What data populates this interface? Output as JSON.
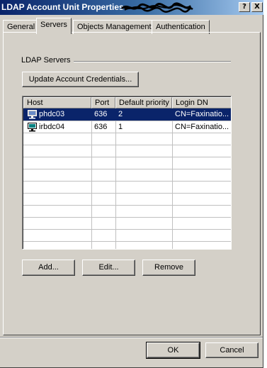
{
  "window": {
    "title": "LDAP Account Unit Properties -",
    "help_btn": "?",
    "close_btn": "X"
  },
  "tabs": [
    {
      "label": "General",
      "active": false
    },
    {
      "label": "Servers",
      "active": true
    },
    {
      "label": "Objects Management",
      "active": false
    },
    {
      "label": "Authentication",
      "active": false
    }
  ],
  "servers": {
    "group_label": "LDAP Servers",
    "update_button": "Update Account Credentials...",
    "columns": [
      "Host",
      "Port",
      "Default priority",
      "Login DN"
    ],
    "rows": [
      {
        "host": "phdc03",
        "port": "636",
        "priority": "2",
        "login_dn": "CN=Faxinatio...",
        "selected": true
      },
      {
        "host": "irbdc04",
        "port": "636",
        "priority": "1",
        "login_dn": "CN=Faxinatio...",
        "selected": false
      }
    ],
    "add_button": "Add...",
    "edit_button": "Edit...",
    "remove_button": "Remove"
  },
  "dialog": {
    "ok_button": "OK",
    "cancel_button": "Cancel"
  },
  "colors": {
    "face": "#d4d0c8",
    "selection": "#0a246a",
    "titlebar_start": "#0a246a"
  }
}
